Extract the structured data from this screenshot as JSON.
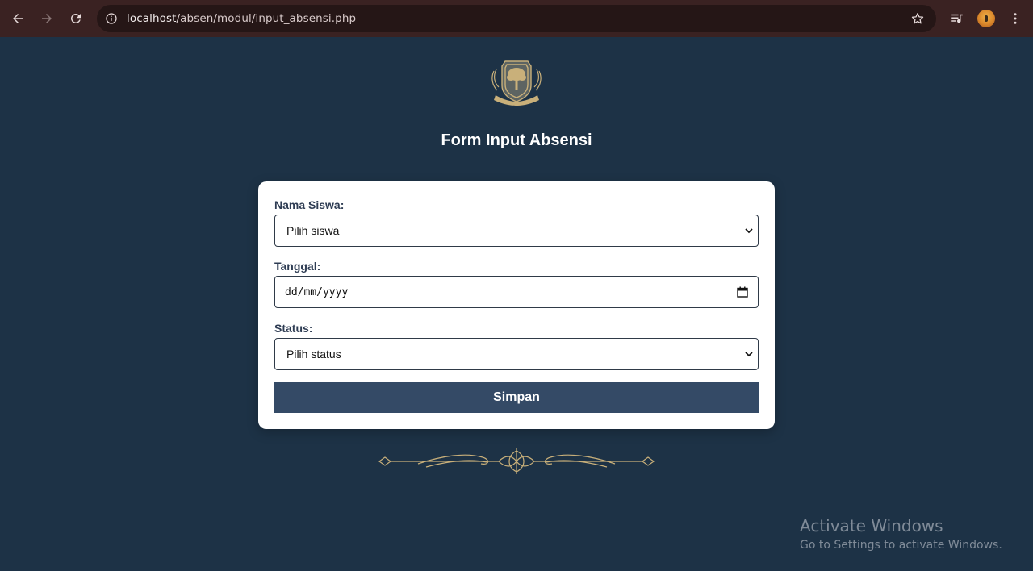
{
  "browser": {
    "url_host": "localhost",
    "url_path": "/absen/modul/input_absensi.php"
  },
  "page": {
    "title": "Form Input Absensi"
  },
  "form": {
    "nama_label": "Nama Siswa:",
    "nama_selected": "Pilih siswa",
    "tanggal_label": "Tanggal:",
    "tanggal_placeholder": "dd/mm/yyyy",
    "status_label": "Status:",
    "status_selected": "Pilih status",
    "submit_label": "Simpan"
  },
  "watermark": {
    "title": "Activate Windows",
    "subtitle": "Go to Settings to activate Windows."
  },
  "colors": {
    "page_bg": "#1d3246",
    "button_bg": "#344a66",
    "chrome_bg": "#3a2222",
    "gold": "#c9b07a"
  }
}
